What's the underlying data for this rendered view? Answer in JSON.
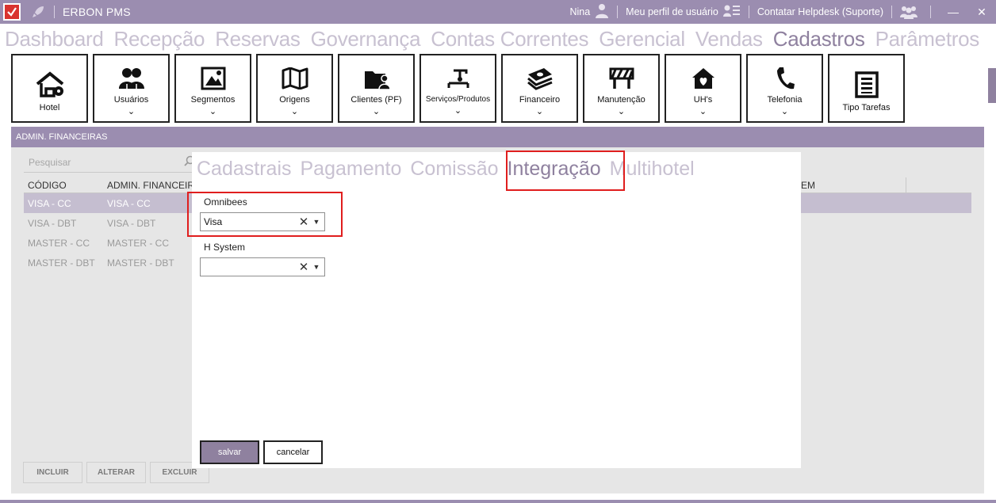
{
  "titlebar": {
    "app_title": "ERBON PMS",
    "user_name": "Nina",
    "profile_link": "Meu perfil de usuário",
    "helpdesk_link": "Contatar Helpdesk (Suporte)",
    "minimize": "—",
    "close": "✕"
  },
  "topnav": [
    {
      "label": "Dashboard",
      "active": false
    },
    {
      "label": "Recepção",
      "active": false
    },
    {
      "label": "Reservas",
      "active": false
    },
    {
      "label": "Governança",
      "active": false
    },
    {
      "label": "Contas Correntes",
      "active": false
    },
    {
      "label": "Gerencial",
      "active": false
    },
    {
      "label": "Vendas",
      "active": false
    },
    {
      "label": "Cadastros",
      "active": true
    },
    {
      "label": "Parâmetros",
      "active": false
    }
  ],
  "ribbon": [
    {
      "label": "Hotel",
      "icon": "house-icon"
    },
    {
      "label": "Usuários",
      "icon": "users-icon",
      "chevron": "⌄"
    },
    {
      "label": "Segmentos",
      "icon": "image-icon",
      "chevron": "⌄"
    },
    {
      "label": "Origens",
      "icon": "map-icon",
      "chevron": "⌄"
    },
    {
      "label": "Clientes (PF)",
      "icon": "client-folder-icon",
      "chevron": "⌄"
    },
    {
      "label": "Serviços/Produtos",
      "icon": "service-icon",
      "chevron": "⌄"
    },
    {
      "label": "Financeiro",
      "icon": "money-icon",
      "chevron": "⌄"
    },
    {
      "label": "Manutenção",
      "icon": "barrier-icon",
      "chevron": "⌄"
    },
    {
      "label": "UH's",
      "icon": "home-heart-icon",
      "chevron": "⌄"
    },
    {
      "label": "Telefonia",
      "icon": "phone-icon",
      "chevron": "⌄"
    },
    {
      "label": "Tipo Tarefas",
      "icon": "list-icon"
    }
  ],
  "panel": {
    "header": "ADMIN. FINANCEIRAS",
    "search_placeholder": "Pesquisar",
    "columns": [
      "CÓDIGO",
      "ADMIN. FINANCEIR",
      "EM"
    ],
    "rows": [
      {
        "codigo": "VISA - CC",
        "admin": "VISA - CC",
        "selected": true
      },
      {
        "codigo": "VISA - DBT",
        "admin": "VISA - DBT",
        "selected": false
      },
      {
        "codigo": "MASTER - CC",
        "admin": "MASTER - CC",
        "selected": false
      },
      {
        "codigo": "MASTER - DBT",
        "admin": "MASTER - DBT",
        "selected": false
      }
    ],
    "buttons": {
      "incluir": "INCLUIR",
      "alterar": "ALTERAR",
      "excluir": "EXCLUIR"
    }
  },
  "modal": {
    "tabs": [
      {
        "label": "Cadastrais",
        "active": false
      },
      {
        "label": "Pagamento",
        "active": false
      },
      {
        "label": "Comissão",
        "active": false
      },
      {
        "label": "Integração",
        "active": true
      },
      {
        "label": "Multihotel",
        "active": false
      }
    ],
    "fields": [
      {
        "label": "Omnibees",
        "value": "Visa"
      },
      {
        "label": "H System",
        "value": ""
      }
    ],
    "clear_glyph": "✕",
    "dropdown_glyph": "▼",
    "save_label": "salvar",
    "cancel_label": "cancelar"
  },
  "colors": {
    "accent": "#9b8db0",
    "accent_dark": "#8f819f",
    "nav_inactive": "#c8c1d1",
    "highlight_red": "#e01e1e",
    "selected_row": "#c5bed0"
  }
}
